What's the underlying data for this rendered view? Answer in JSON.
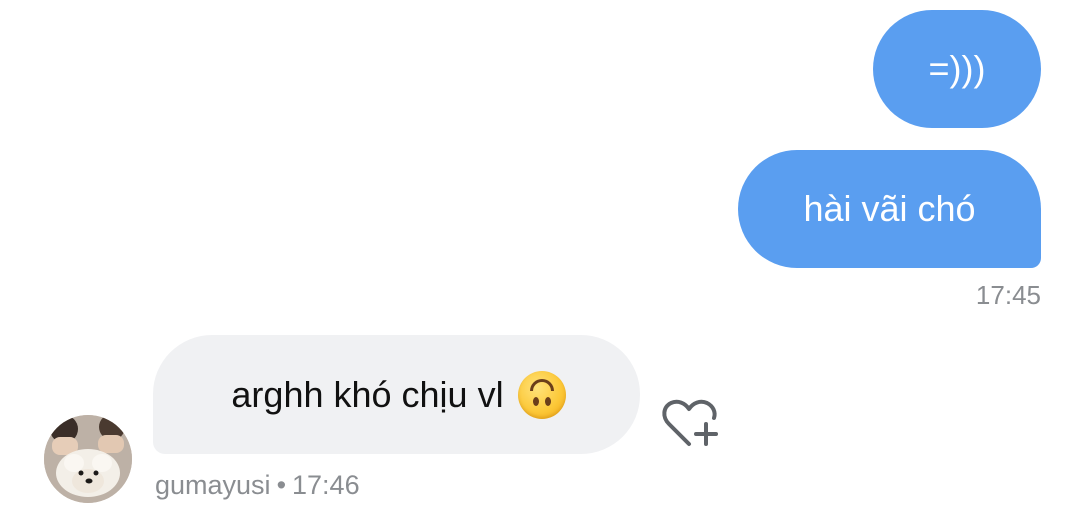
{
  "messages": [
    {
      "direction": "sent",
      "text": "=)))"
    },
    {
      "direction": "sent",
      "text": "hài vãi chó"
    },
    {
      "direction": "received",
      "text": "arghh khó chịu vl",
      "emoji": "upside-down-face"
    }
  ],
  "sent_timestamp": "17:45",
  "received_meta": {
    "username": "gumayusi",
    "separator": "•",
    "timestamp": "17:46"
  },
  "reaction_icon": "heart-plus-icon",
  "colors": {
    "sent_bubble": "#5a9ef0",
    "received_bubble": "#f0f1f3",
    "meta_text": "#8a8d91"
  }
}
